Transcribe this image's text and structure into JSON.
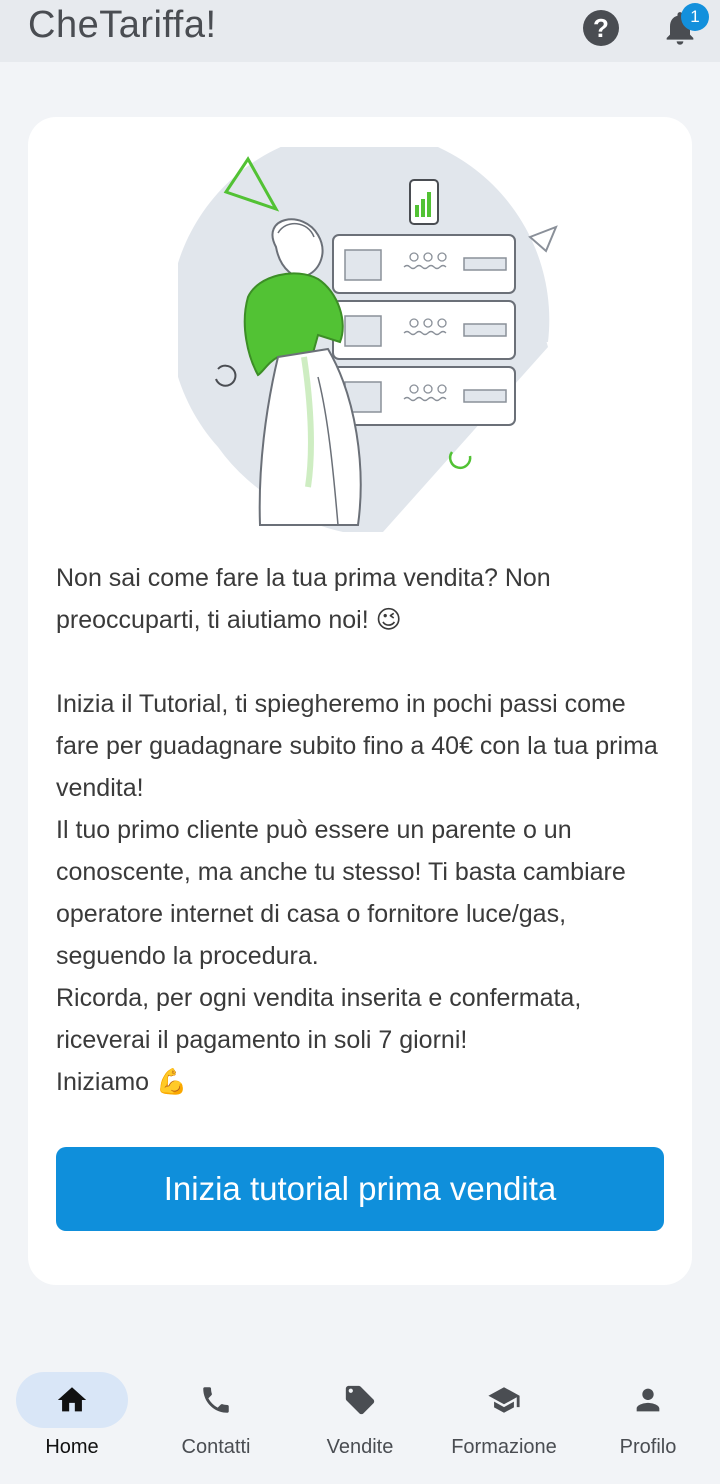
{
  "header": {
    "title": "CheTariffa!",
    "help_icon": "help-circle-icon",
    "bell_icon": "bell-icon",
    "notification_count": "1"
  },
  "card": {
    "paragraphs_group1": [
      "Non sai come fare la tua prima vendita? Non preoccuparti, ti aiutiamo noi! 😉"
    ],
    "paragraphs_group2": [
      "Inizia il Tutorial, ti spiegheremo in pochi passi come fare per guadagnare subito fino a 40€ con la tua prima vendita!",
      "Il tuo primo cliente può essere un parente o un conoscente, ma anche tu stesso! Ti basta cambiare operatore internet di casa o fornitore luce/gas, seguendo la procedura.",
      "Ricorda, per ogni vendita inserita e confermata, riceverai il pagamento in soli 7 giorni!",
      "Iniziamo 💪"
    ],
    "cta_label": "Inizia tutorial prima vendita"
  },
  "nav": {
    "items": [
      {
        "label": "Home",
        "icon": "home-icon",
        "active": true
      },
      {
        "label": "Contatti",
        "icon": "phone-icon",
        "active": false
      },
      {
        "label": "Vendite",
        "icon": "tag-icon",
        "active": false
      },
      {
        "label": "Formazione",
        "icon": "graduation-cap-icon",
        "active": false
      },
      {
        "label": "Profilo",
        "icon": "person-icon",
        "active": false
      }
    ]
  },
  "colors": {
    "accent": "#0f8fdb",
    "header_bg": "#e7eaee",
    "page_bg": "#f2f4f7",
    "illustration_green": "#52c234"
  }
}
